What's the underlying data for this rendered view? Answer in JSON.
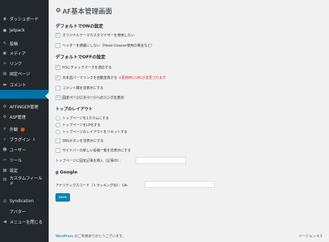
{
  "sidebar": {
    "items": [
      {
        "label": "ダッシュボード",
        "icon": "dashboard-icon",
        "glyph": "◉"
      },
      {
        "label": "Jetpack",
        "icon": "jetpack-icon",
        "glyph": "●"
      },
      {
        "label": "投稿",
        "icon": "pin-icon",
        "glyph": "✎"
      },
      {
        "label": "メディア",
        "icon": "media-icon",
        "glyph": "▣"
      },
      {
        "label": "リンク",
        "icon": "link-icon",
        "glyph": "∞"
      },
      {
        "label": "固定ページ",
        "icon": "page-icon",
        "glyph": "▤"
      },
      {
        "label": "コメント",
        "icon": "comment-icon",
        "glyph": "▬"
      },
      {
        "label": "AFFINGER管理",
        "icon": "gear-icon",
        "glyph": "⚙"
      },
      {
        "label": "ASP管理",
        "icon": "gear-icon",
        "glyph": "⚙"
      },
      {
        "label": "外観",
        "icon": "brush-icon",
        "glyph": "✐"
      },
      {
        "label": "プラグイン",
        "icon": "plugin-icon",
        "glyph": "⚡",
        "badge_text": "1"
      },
      {
        "label": "ユーザー",
        "icon": "user-icon",
        "glyph": "☻"
      },
      {
        "label": "ツール",
        "icon": "tool-icon",
        "glyph": "✂"
      },
      {
        "label": "設定",
        "icon": "settings-icon",
        "glyph": "▦"
      },
      {
        "label": "カスタムフィールド",
        "icon": "custom-field-icon",
        "glyph": "▤"
      },
      {
        "label": "Syndication",
        "icon": "syndication-icon",
        "glyph": "◎"
      },
      {
        "label": "アバター",
        "icon": "avatar-icon",
        "glyph": ""
      },
      {
        "label": "メニューを閉じる",
        "icon": "collapse-icon",
        "glyph": "◀"
      }
    ]
  },
  "main": {
    "title": "AF基本管理画面",
    "section_on_title": "デフォルトでONの設定",
    "on_options": [
      {
        "label": "オリジナルテーマカスタマイザーを使用しない",
        "checked": true
      },
      {
        "label": "ヘッダーを綺麗にしない（Head Cleaner使用の場合など）",
        "checked": false
      }
    ],
    "section_off_title": "デフォルトでOFFの設定",
    "off_options": [
      {
        "label": "H3にチェックマークを適応する",
        "checked": true
      },
      {
        "label": "日本語パーマリンクを自動変換する",
        "checked": true,
        "note": "※更新時にURLが変更されます"
      },
      {
        "label": "コメント欄を非表示にする",
        "checked": false
      },
      {
        "label": "固定ページに子ページへのリンクを表示",
        "checked": true
      }
    ],
    "layout_title": "トップのレイアウト",
    "layout_options": [
      {
        "label": "トップページを1カラムにする"
      },
      {
        "label": "トップページをLP化する"
      },
      {
        "label": "トップページのレイアウトをリセットする"
      }
    ],
    "extra_options": [
      {
        "label": "SNSボタンを非表示にする",
        "checked": false
      },
      {
        "label": "サイドバーの新しい投稿一覧を非表示にする",
        "checked": false
      }
    ],
    "fixed_article_label": "トップページに固定記事を挿入（記事ID）：",
    "fixed_article_value": "",
    "google_title": "Google",
    "analytics_label": "アナリティクスコード（トラッキングID）：UA-",
    "analytics_value": "",
    "save_label": "save"
  },
  "footer": {
    "link_text": "WordPress",
    "thanks": " のご利用ありがとうございます。",
    "version": "バージョン 4.3"
  }
}
